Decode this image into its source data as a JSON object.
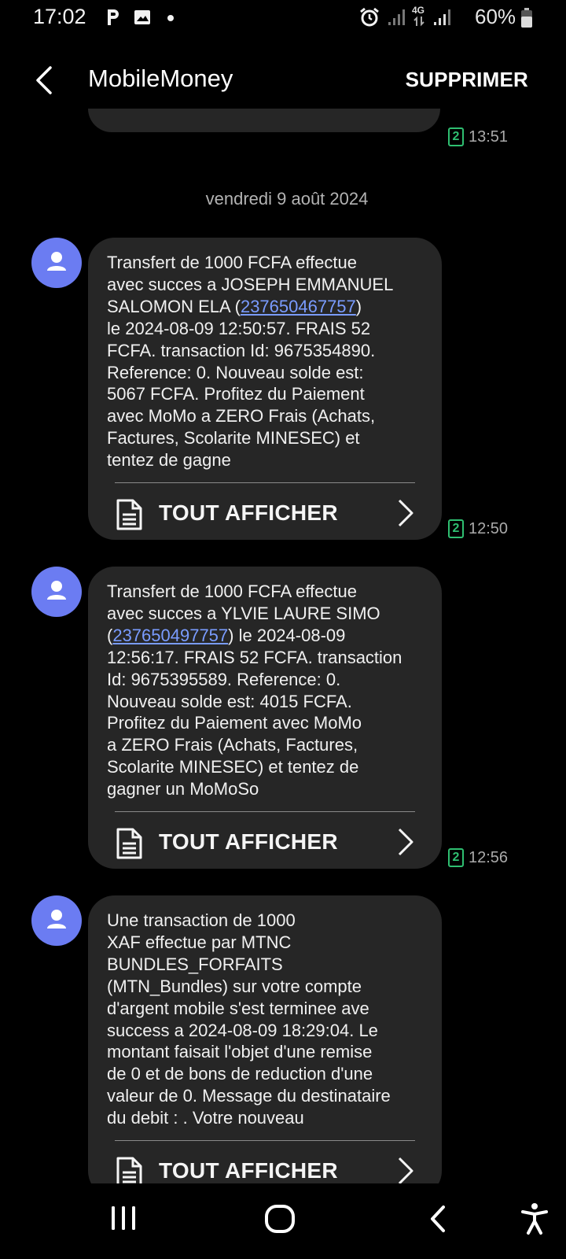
{
  "status_bar": {
    "time": "17:02",
    "battery": "60%",
    "network": "4G",
    "icons": [
      "parking-icon",
      "image-icon",
      "dot-icon",
      "alarm-icon",
      "signal-icon",
      "signal-icon",
      "battery-icon"
    ]
  },
  "app_bar": {
    "title": "MobileMoney",
    "delete_label": "SUPPRIMER"
  },
  "thread": {
    "previous_time": "13:51",
    "date_separator": "vendredi 9 août 2024",
    "messages": [
      {
        "text_before": "Transfert de 1000 FCFA effectue\navec succes a JOSEPH EMMANUEL\nSALOMON ELA (",
        "number": "237650467757",
        "text_after": ")\nle 2024-08-09 12:50:57. FRAIS 52\nFCFA. transaction Id: 9675354890.\nReference: 0. Nouveau solde est:\n5067 FCFA. Profitez du Paiement\navec MoMo a ZERO Frais (Achats,\nFactures, Scolarite MINESEC) et\ntentez de gagne",
        "show_all": "TOUT AFFICHER",
        "sim": "2",
        "time": "12:50"
      },
      {
        "text_before": "Transfert de 1000 FCFA effectue\navec succes a YLVIE LAURE SIMO\n(",
        "number": "237650497757",
        "text_after": ") le 2024-08-09\n12:56:17. FRAIS 52 FCFA. transaction\nId: 9675395589. Reference: 0.\nNouveau solde est: 4015 FCFA.\nProfitez du Paiement avec MoMo\na ZERO Frais (Achats, Factures,\nScolarite MINESEC) et tentez de\ngagner un MoMoSo",
        "show_all": "TOUT AFFICHER",
        "sim": "2",
        "time": "12:56"
      },
      {
        "text_before": "Une transaction de 1000\nXAF effectue par MTNC\nBUNDLES_FORFAITS\n(MTN_Bundles) sur votre compte\nd'argent mobile s'est terminee ave\nsuccess a 2024-08-09 18:29:04. Le\nmontant faisait l'objet d'une remise\nde 0 et de bons de reduction d'une\nvaleur de 0. Message du destinataire\ndu debit : . Votre nouveau",
        "number": "",
        "text_after": "",
        "show_all": "TOUT AFFICHER",
        "sim": "",
        "time": ""
      }
    ]
  },
  "nav_bar": {
    "icons": [
      "recents-icon",
      "home-icon",
      "back-icon",
      "accessibility-icon"
    ]
  }
}
